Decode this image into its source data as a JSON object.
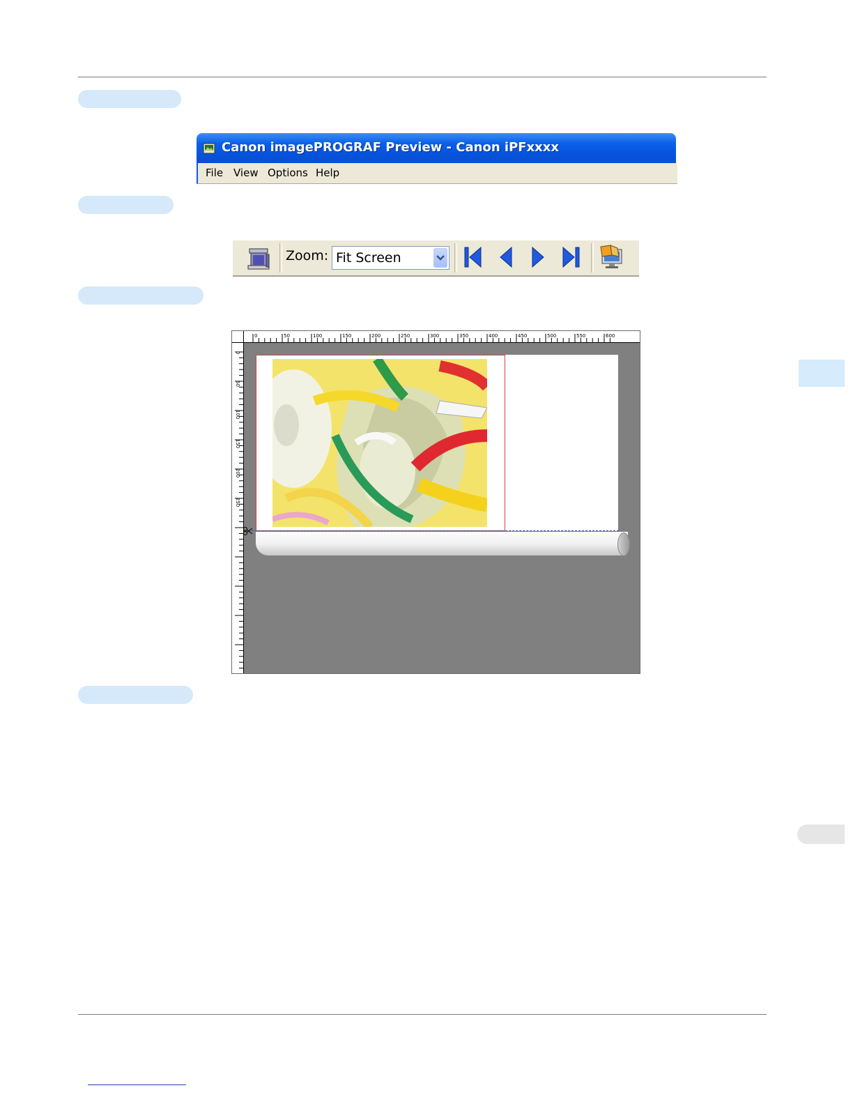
{
  "window": {
    "title": "Canon imagePROGRAF Preview - Canon iPFxxxx",
    "menu": [
      "File",
      "View",
      "Options",
      "Help"
    ]
  },
  "toolbar": {
    "zoom_label": "Zoom:",
    "zoom_value": "Fit Screen"
  },
  "ruler": {
    "horizontal": [
      "0",
      "50",
      "100",
      "150",
      "200",
      "250",
      "300",
      "350",
      "400",
      "450",
      "500",
      "550",
      "600"
    ],
    "vertical": [
      "0",
      "50",
      "100",
      "150",
      "200",
      "250"
    ]
  },
  "icons": {
    "printer": "printer-icon",
    "first_page": "first-page-icon",
    "prev_page": "previous-page-icon",
    "next_page": "next-page-icon",
    "last_page": "last-page-icon",
    "preview_monitor": "preview-monitor-icon",
    "cut": "scissors-icon"
  },
  "colors": {
    "titlebar_blue": "#0a5fe8",
    "nav_blue": "#1f5ae0",
    "pill_blue": "#d5e9fa",
    "canvas_gray": "#808080"
  }
}
